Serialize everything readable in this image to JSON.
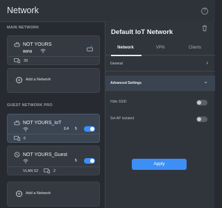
{
  "header": {
    "title": "Network",
    "help_icon": "?"
  },
  "sections": {
    "main": "MAIN NETWORK",
    "guest": "GUEST NETWORK PRO"
  },
  "main_card": {
    "name": "NOT YOURS",
    "wifi_label": "WiFi6",
    "device_count": "39"
  },
  "add_network_label": "Add a Network",
  "iot_card": {
    "name": "NOT YOURS_IoT",
    "band_a": "2.4",
    "band_b": "5",
    "device_count": "6",
    "enabled": true
  },
  "guest_card": {
    "name": "NOT YOURS_Guest",
    "band": "5",
    "vlan_label": "VLAN",
    "vlan_value": "52",
    "device_count": "2",
    "enabled": true
  },
  "add_network_label_2": "Add a Network",
  "panel": {
    "title": "Default IoT Network",
    "tabs": [
      "Network",
      "VPN",
      "Clients"
    ],
    "general_label": "General",
    "advanced_label": "Advanced Settings",
    "hide_ssid_label": "Hide SSID",
    "hide_ssid": false,
    "ap_isolated_label": "Set AP Isolated",
    "ap_isolated": false,
    "apply_label": "Apply"
  },
  "colors": {
    "accent": "#3d8ef5",
    "background": "#272b31",
    "card": "#353a42"
  }
}
